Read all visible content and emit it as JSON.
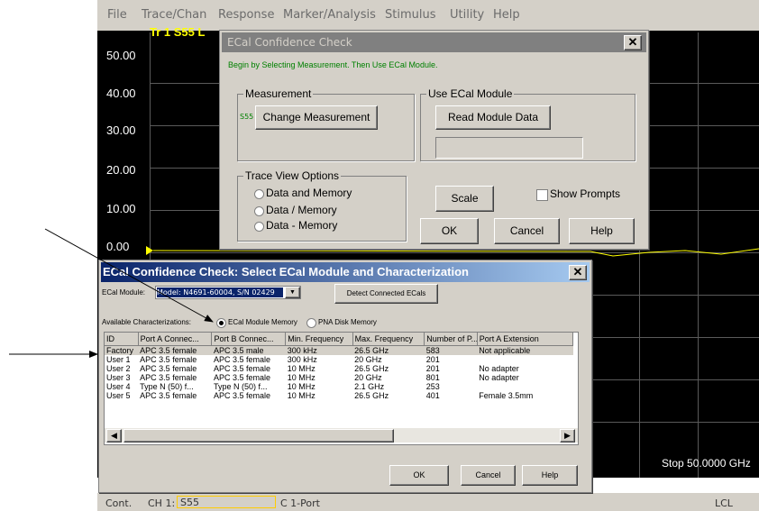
{
  "menu": [
    "File",
    "Trace/Chan",
    "Response",
    "Marker/Analysis",
    "Stimulus",
    "Utility",
    "Help"
  ],
  "plot": {
    "trace_label": "Tr 1  S55",
    "trace_label_suffix": "L",
    "y_ticks": [
      "50.00",
      "40.00",
      "30.00",
      "20.00",
      "10.00",
      "0.00"
    ],
    "stop_label": "Stop  50.0000 GHz"
  },
  "status": {
    "mode": "Cont.",
    "channel": "CH 1:",
    "param": "S55",
    "port": "C 1-Port",
    "remote": "LCL"
  },
  "ecal_check": {
    "title": "ECal Confidence Check",
    "instruction": "Begin by Selecting Measurement. Then Use ECal Module.",
    "measurement_group": "Measurement",
    "measurement_value": "S55",
    "change_measurement": "Change Measurement",
    "ecal_group": "Use ECal Module",
    "read_module_data": "Read Module Data",
    "trace_view_group": "Trace View Options",
    "trace_options": [
      "Data and Memory",
      "Data / Memory",
      "Data - Memory"
    ],
    "scale": "Scale",
    "show_prompts": "Show Prompts",
    "ok": "OK",
    "cancel": "Cancel",
    "help": "Help",
    "close": "✕"
  },
  "select_module": {
    "title": "ECal Confidence Check: Select ECal Module and Characterization",
    "module_label": "ECal Module:",
    "module_value": "Model: N4691-60004, S/N 02429",
    "detect_button": "Detect Connected ECals",
    "available_label": "Available Characterizations:",
    "radio_module": "ECal Module Memory",
    "radio_disk": "PNA Disk Memory",
    "columns": [
      "ID",
      "Port A Connec...",
      "Port B Connec...",
      "Min. Frequency",
      "Max. Frequency",
      "Number of P...",
      "Port A Extension"
    ],
    "rows": [
      [
        "Factory",
        "APC 3.5 female",
        "APC 3.5 male",
        "300 kHz",
        "26.5 GHz",
        "583",
        "Not applicable"
      ],
      [
        "User 1",
        "APC 3.5 female",
        "APC 3.5 female",
        "300 kHz",
        "20 GHz",
        "201",
        ""
      ],
      [
        "User 2",
        "APC 3.5 female",
        "APC 3.5 female",
        "10 MHz",
        "26.5 GHz",
        "201",
        "No adapter"
      ],
      [
        "User 3",
        "APC 3.5 female",
        "APC 3.5 female",
        "10 MHz",
        "20 GHz",
        "801",
        "No adapter"
      ],
      [
        "User 4",
        "Type N (50) f...",
        "Type N (50) f...",
        "10 MHz",
        "2.1 GHz",
        "253",
        ""
      ],
      [
        "User 5",
        "APC 3.5 female",
        "APC 3.5 female",
        "10 MHz",
        "26.5 GHz",
        "401",
        "Female 3.5mm"
      ]
    ],
    "ok": "OK",
    "cancel": "Cancel",
    "help": "Help",
    "close": "✕"
  },
  "colors": {
    "trace_yellow": "#ffff00",
    "title_active": "#0a246a",
    "title_inactive": "#808080",
    "instruction_green": "#008000"
  }
}
